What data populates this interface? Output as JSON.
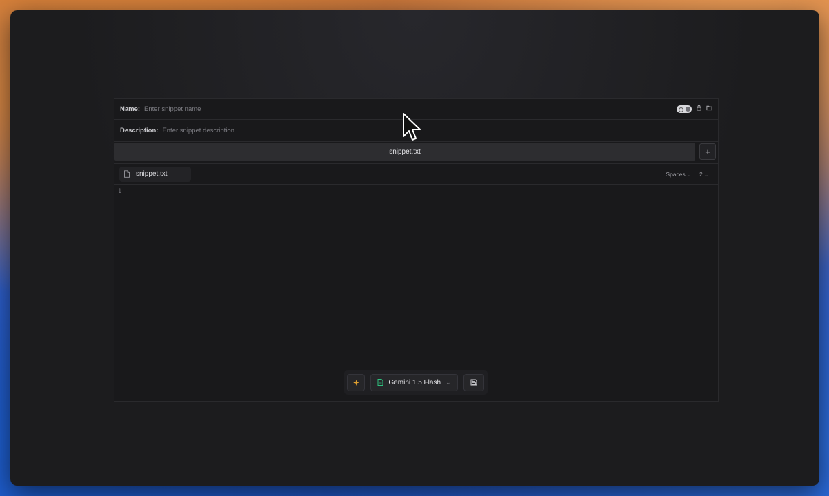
{
  "form": {
    "name_label": "Name:",
    "name_placeholder": "Enter snippet name",
    "description_label": "Description:",
    "description_placeholder": "Enter snippet description"
  },
  "tabs": {
    "active": "snippet.txt",
    "add_label": "+"
  },
  "editor": {
    "file_name": "snippet.txt",
    "indent_mode": "Spaces",
    "indent_size": "2",
    "line_numbers": [
      "1"
    ]
  },
  "toolbar": {
    "model_label": "Gemini 1.5 Flash"
  },
  "colors": {
    "window_bg": "#1c1c1e",
    "panel_bg": "#19191b",
    "tab_bg": "#2d2d30",
    "model_icon": "#2ec27e",
    "sparkle_icon": "#e0a030"
  },
  "icons": [
    "file-icon",
    "toggle-icon",
    "lock-icon",
    "folder-icon",
    "plus-icon",
    "sparkle-icon",
    "gemini-icon",
    "chevron-down-icon",
    "save-icon",
    "mouse-cursor-icon"
  ]
}
